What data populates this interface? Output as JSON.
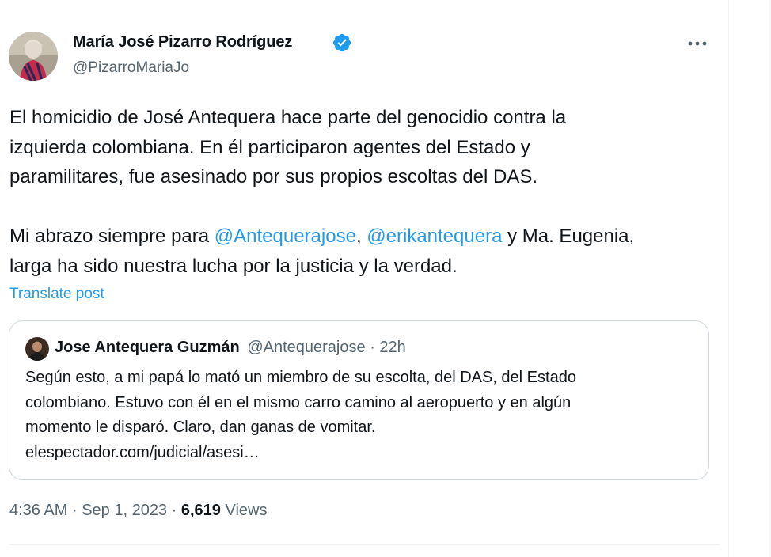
{
  "author": {
    "name": "María José Pizarro Rodríguez",
    "handle": "@PizarroMariaJo",
    "verified_icon": "verified-badge-icon",
    "avatar_icon": "profile-photo-avatar"
  },
  "more_icon": "more-horizontal-icon",
  "tweet": {
    "lines": [
      [
        {
          "text": "El homicidio de José Antequera hace parte del genocidio contra la"
        }
      ],
      [
        {
          "text": "izquierda colombiana. En él participaron agentes del Estado y"
        }
      ],
      [
        {
          "text": "paramilitares, fue asesinado por sus propios escoltas del DAS."
        }
      ],
      [],
      [
        {
          "text": "Mi abrazo siempre para "
        },
        {
          "text": "@Antequerajose",
          "mention": true
        },
        {
          "text": ", "
        },
        {
          "text": "@erikantequera",
          "mention": true
        },
        {
          "text": " y Ma. Eugenia,"
        }
      ],
      [
        {
          "text": "larga ha sido nuestra lucha por la justicia y la verdad."
        }
      ]
    ]
  },
  "translate_label": "Translate post",
  "quote": {
    "name": "Jose Antequera Guzmán",
    "handle": "@Antequerajose",
    "separator": "·",
    "time": "22h",
    "lines": [
      "Según esto, a mi papá lo mató un miembro de su escolta, del DAS, del Estado",
      "colombiano. Estuvo con él en el mismo carro camino al aeropuerto y en algún",
      "momento le disparó. Claro, dan ganas de vomitar.",
      "elespectador.com/judicial/asesi…"
    ]
  },
  "meta": {
    "time": "4:36 AM",
    "separator": "·",
    "date": "Sep 1, 2023",
    "views_count": "6,619",
    "views_label": "Views"
  },
  "colors": {
    "link_blue": "#1d9bf0",
    "text_primary": "#0f1419",
    "text_secondary": "#536471",
    "border": "#cfd9de"
  }
}
